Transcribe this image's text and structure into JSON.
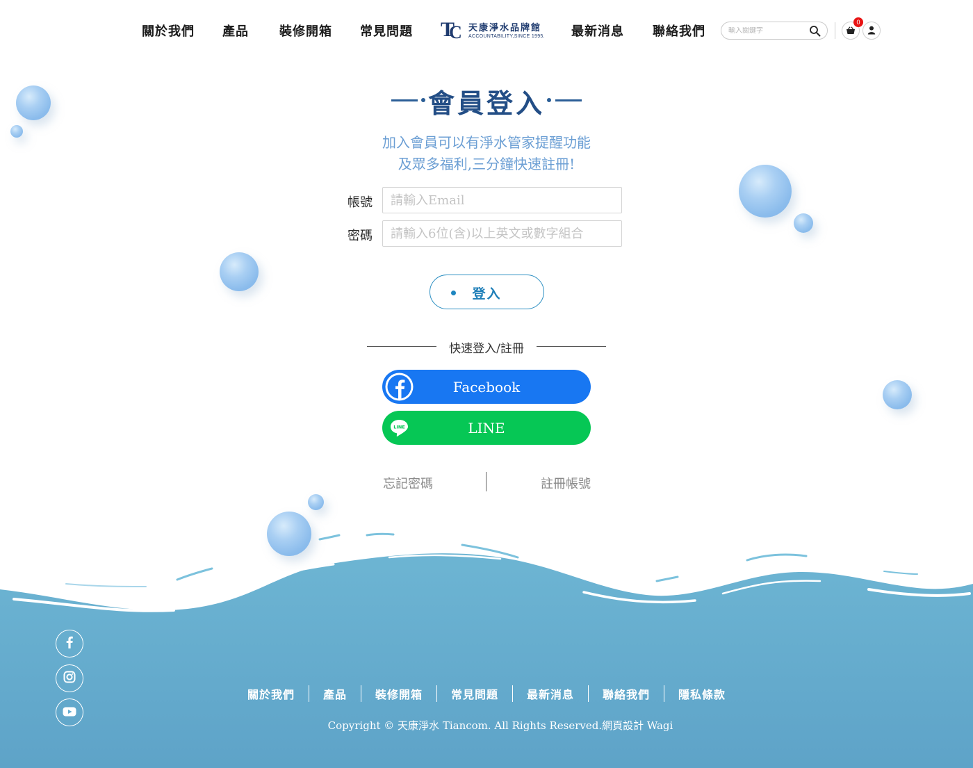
{
  "nav": {
    "items": [
      {
        "label": "關於我們"
      },
      {
        "label": "產品"
      },
      {
        "label": "裝修開箱"
      },
      {
        "label": "常見問題"
      },
      {
        "label": "最新消息"
      },
      {
        "label": "聯絡我們"
      }
    ],
    "logo": {
      "brand_zh": "天康淨水品牌館",
      "tagline": "ACCOUNTABILITY,SINCE 1995."
    },
    "search": {
      "placeholder": "輸入關鍵字"
    },
    "cart": {
      "count": "0"
    }
  },
  "login": {
    "title": "會員登入",
    "subtitle_line1": "加入會員可以有淨水管家提醒功能",
    "subtitle_line2": "及眾多福利,三分鐘快速註冊!",
    "account_label": "帳號",
    "account_placeholder": "請輸入Email",
    "password_label": "密碼",
    "password_placeholder": "請輸入6位(含)以上英文或數字組合",
    "submit_label": "登入",
    "quick_label": "快速登入/註冊",
    "facebook_label": "Facebook",
    "line_label": "LINE",
    "forgot_label": "忘記密碼",
    "register_label": "註冊帳號"
  },
  "footer": {
    "links": [
      {
        "label": "關於我們"
      },
      {
        "label": "產品"
      },
      {
        "label": "裝修開箱"
      },
      {
        "label": "常見問題"
      },
      {
        "label": "最新消息"
      },
      {
        "label": "聯絡我們"
      },
      {
        "label": "隱私條款"
      }
    ],
    "copyright": "Copyright © 天康淨水 Tiancom. All Rights Reserved.網頁設計 Wagi",
    "social": [
      "facebook-icon",
      "instagram-icon",
      "youtube-icon"
    ]
  },
  "colors": {
    "title": "#234e86",
    "subtitle": "#6c9fd4",
    "facebook": "#1877f2",
    "line": "#06c755",
    "water": "#6eb3d1",
    "cart_badge": "#e81313"
  }
}
